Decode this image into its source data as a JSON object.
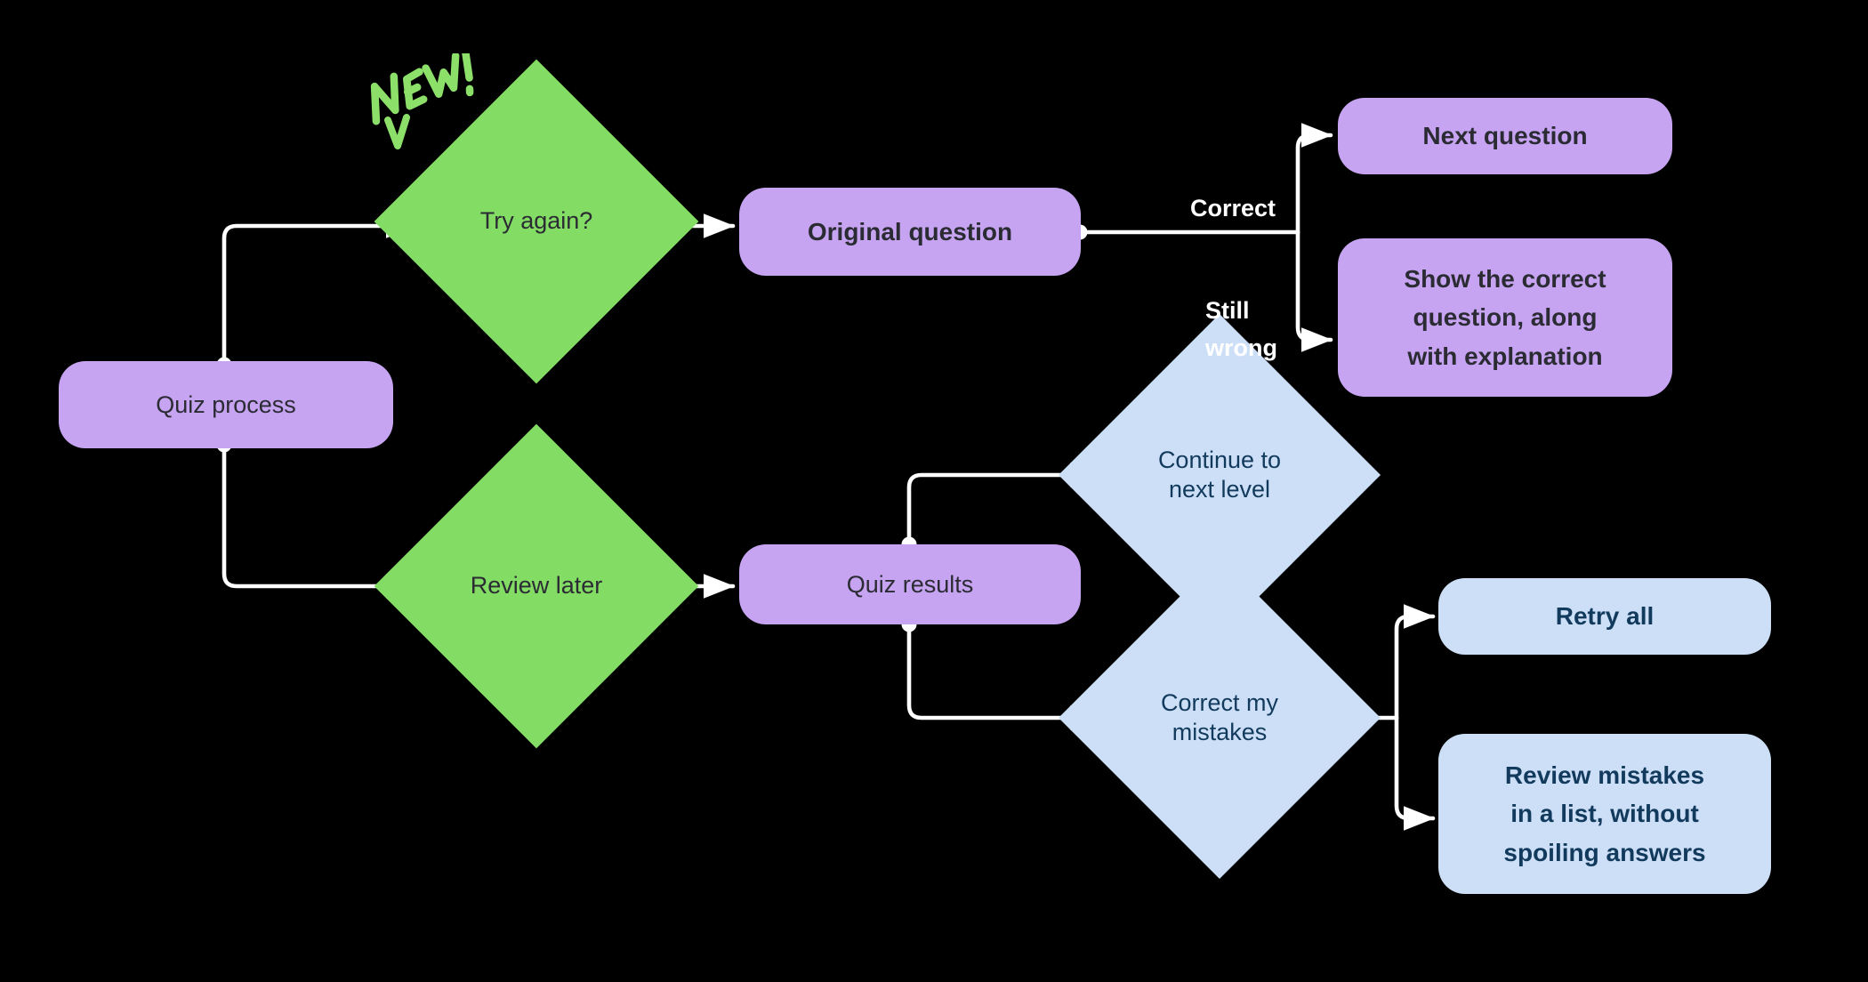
{
  "diagram": {
    "title": "Quiz process flowchart",
    "background_color": "#000000",
    "connector_color": "#FFFFFF",
    "palette": {
      "purple_fill": "#C6A4F2",
      "purple_text": "#2B2B33",
      "blue_fill": "#CCDFF7",
      "blue_text": "#123A5C",
      "green_fill": "#83DC64",
      "green_text": "#2B2B33",
      "annotation_green": "#8CE06A"
    },
    "annotation": {
      "text": "NEW!",
      "shape": "handwritten-marker-with-chevron",
      "color": "#8CE06A"
    },
    "nodes": [
      {
        "id": "quiz_process",
        "label": "Quiz process",
        "shape": "rounded-rect",
        "color": "purple"
      },
      {
        "id": "try_again",
        "label": "Try again?",
        "shape": "diamond",
        "color": "green"
      },
      {
        "id": "review_later",
        "label": "Review later",
        "shape": "diamond",
        "color": "green"
      },
      {
        "id": "original_q",
        "label": "Original question",
        "shape": "rounded-rect",
        "color": "purple"
      },
      {
        "id": "quiz_results",
        "label": "Quiz results",
        "shape": "rounded-rect",
        "color": "purple"
      },
      {
        "id": "next_question",
        "label": "Next question",
        "shape": "rounded-rect",
        "color": "purple"
      },
      {
        "id": "show_correct",
        "label": "Show the correct\nquestion, along\nwith explanation",
        "shape": "rounded-rect",
        "color": "purple"
      },
      {
        "id": "continue_level",
        "label": "Continue to\nnext level",
        "shape": "diamond",
        "color": "blue"
      },
      {
        "id": "correct_mistakes",
        "label": "Correct my\nmistakes",
        "shape": "diamond",
        "color": "blue"
      },
      {
        "id": "retry_all",
        "label": "Retry all",
        "shape": "rounded-rect",
        "color": "blue"
      },
      {
        "id": "review_mistakes",
        "label": "Review mistakes\nin a list, without\nspoiling answers",
        "shape": "rounded-rect",
        "color": "blue"
      }
    ],
    "edges": [
      {
        "from": "quiz_process",
        "to": "try_again",
        "label": ""
      },
      {
        "from": "quiz_process",
        "to": "review_later",
        "label": ""
      },
      {
        "from": "try_again",
        "to": "original_q",
        "label": ""
      },
      {
        "from": "original_q",
        "to": "next_question",
        "label": "Correct"
      },
      {
        "from": "original_q",
        "to": "show_correct",
        "label": "Still\nwrong"
      },
      {
        "from": "review_later",
        "to": "quiz_results",
        "label": ""
      },
      {
        "from": "quiz_results",
        "to": "continue_level",
        "label": ""
      },
      {
        "from": "quiz_results",
        "to": "correct_mistakes",
        "label": ""
      },
      {
        "from": "correct_mistakes",
        "to": "retry_all",
        "label": ""
      },
      {
        "from": "correct_mistakes",
        "to": "review_mistakes",
        "label": ""
      }
    ],
    "edge_labels": {
      "correct": "Correct",
      "still_wrong": "Still\nwrong"
    }
  }
}
